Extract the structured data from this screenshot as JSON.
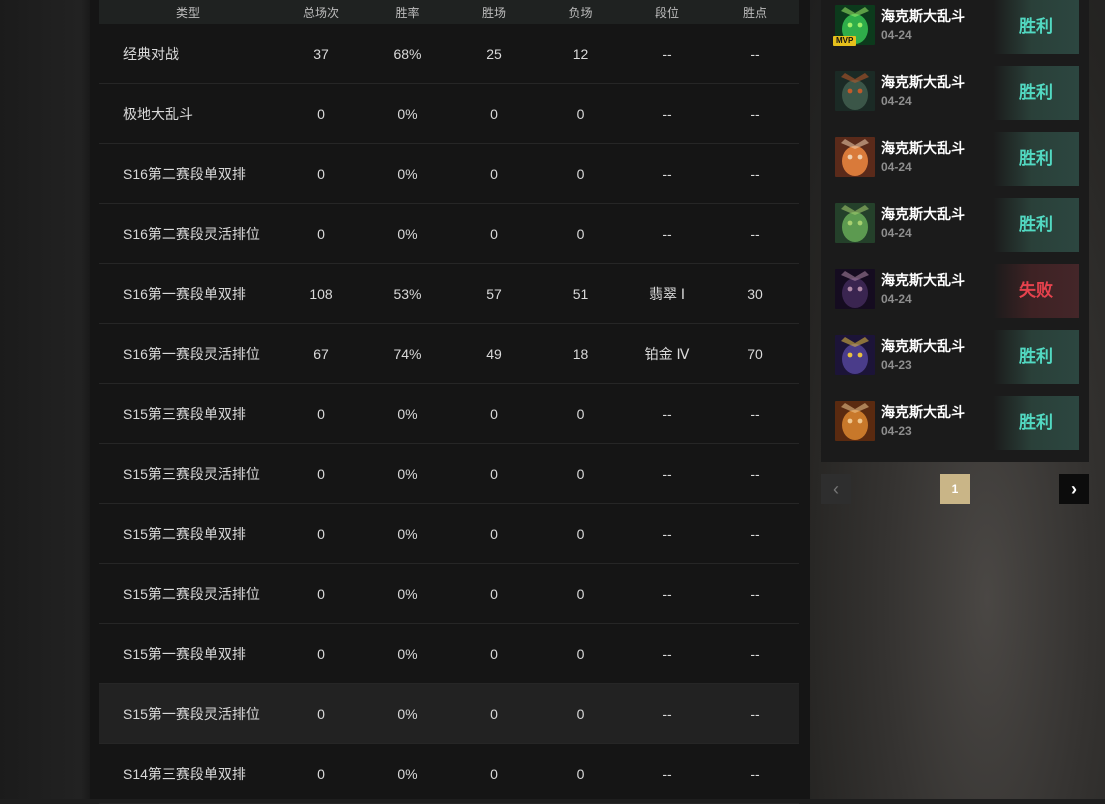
{
  "stats": {
    "headers": [
      "类型",
      "总场次",
      "胜率",
      "胜场",
      "负场",
      "段位",
      "胜点"
    ],
    "rows": [
      [
        "经典对战",
        "37",
        "68%",
        "25",
        "12",
        "--",
        "--"
      ],
      [
        "极地大乱斗",
        "0",
        "0%",
        "0",
        "0",
        "--",
        "--"
      ],
      [
        "S16第二赛段单双排",
        "0",
        "0%",
        "0",
        "0",
        "--",
        "--"
      ],
      [
        "S16第二赛段灵活排位",
        "0",
        "0%",
        "0",
        "0",
        "--",
        "--"
      ],
      [
        "S16第一赛段单双排",
        "108",
        "53%",
        "57",
        "51",
        "翡翠 Ⅰ",
        "30"
      ],
      [
        "S16第一赛段灵活排位",
        "67",
        "74%",
        "49",
        "18",
        "铂金 Ⅳ",
        "70"
      ],
      [
        "S15第三赛段单双排",
        "0",
        "0%",
        "0",
        "0",
        "--",
        "--"
      ],
      [
        "S15第三赛段灵活排位",
        "0",
        "0%",
        "0",
        "0",
        "--",
        "--"
      ],
      [
        "S15第二赛段单双排",
        "0",
        "0%",
        "0",
        "0",
        "--",
        "--"
      ],
      [
        "S15第二赛段灵活排位",
        "0",
        "0%",
        "0",
        "0",
        "--",
        "--"
      ],
      [
        "S15第一赛段单双排",
        "0",
        "0%",
        "0",
        "0",
        "--",
        "--"
      ],
      [
        "S15第一赛段灵活排位",
        "0",
        "0%",
        "0",
        "0",
        "--",
        "--"
      ],
      [
        "S14第三赛段单双排",
        "0",
        "0%",
        "0",
        "0",
        "--",
        "--"
      ]
    ]
  },
  "matches": [
    {
      "mode": "海克斯大乱斗",
      "date": "04-24",
      "result": "胜利",
      "outcome": "win",
      "mvp": "MVP",
      "icon": "champion-green-icon",
      "colors": [
        "#0c3a1c",
        "#2fae4a",
        "#9ff06a"
      ]
    },
    {
      "mode": "海克斯大乱斗",
      "date": "04-24",
      "result": "胜利",
      "outcome": "win",
      "icon": "champion-dark-icon",
      "colors": [
        "#1b2a25",
        "#3b5648",
        "#c05a2a"
      ]
    },
    {
      "mode": "海克斯大乱斗",
      "date": "04-24",
      "result": "胜利",
      "outcome": "win",
      "icon": "champion-fox-icon",
      "colors": [
        "#5a2a1a",
        "#d97a3a",
        "#f0d0b0"
      ]
    },
    {
      "mode": "海克斯大乱斗",
      "date": "04-24",
      "result": "胜利",
      "outcome": "win",
      "icon": "champion-zombie-icon",
      "colors": [
        "#24402a",
        "#5c9a50",
        "#a8d070"
      ]
    },
    {
      "mode": "海克斯大乱斗",
      "date": "04-24",
      "result": "失败",
      "outcome": "loss",
      "icon": "champion-witch-icon",
      "colors": [
        "#150c20",
        "#3a2550",
        "#b08aa8"
      ]
    },
    {
      "mode": "海克斯大乱斗",
      "date": "04-23",
      "result": "胜利",
      "outcome": "win",
      "icon": "champion-void-icon",
      "colors": [
        "#1c1438",
        "#4a3c8a",
        "#e8c040"
      ]
    },
    {
      "mode": "海克斯大乱斗",
      "date": "04-23",
      "result": "胜利",
      "outcome": "win",
      "icon": "champion-warrior-icon",
      "colors": [
        "#5a2a10",
        "#c8782a",
        "#f0c890"
      ]
    }
  ],
  "pagination": {
    "prev": "‹",
    "current": "1",
    "next": "›"
  }
}
